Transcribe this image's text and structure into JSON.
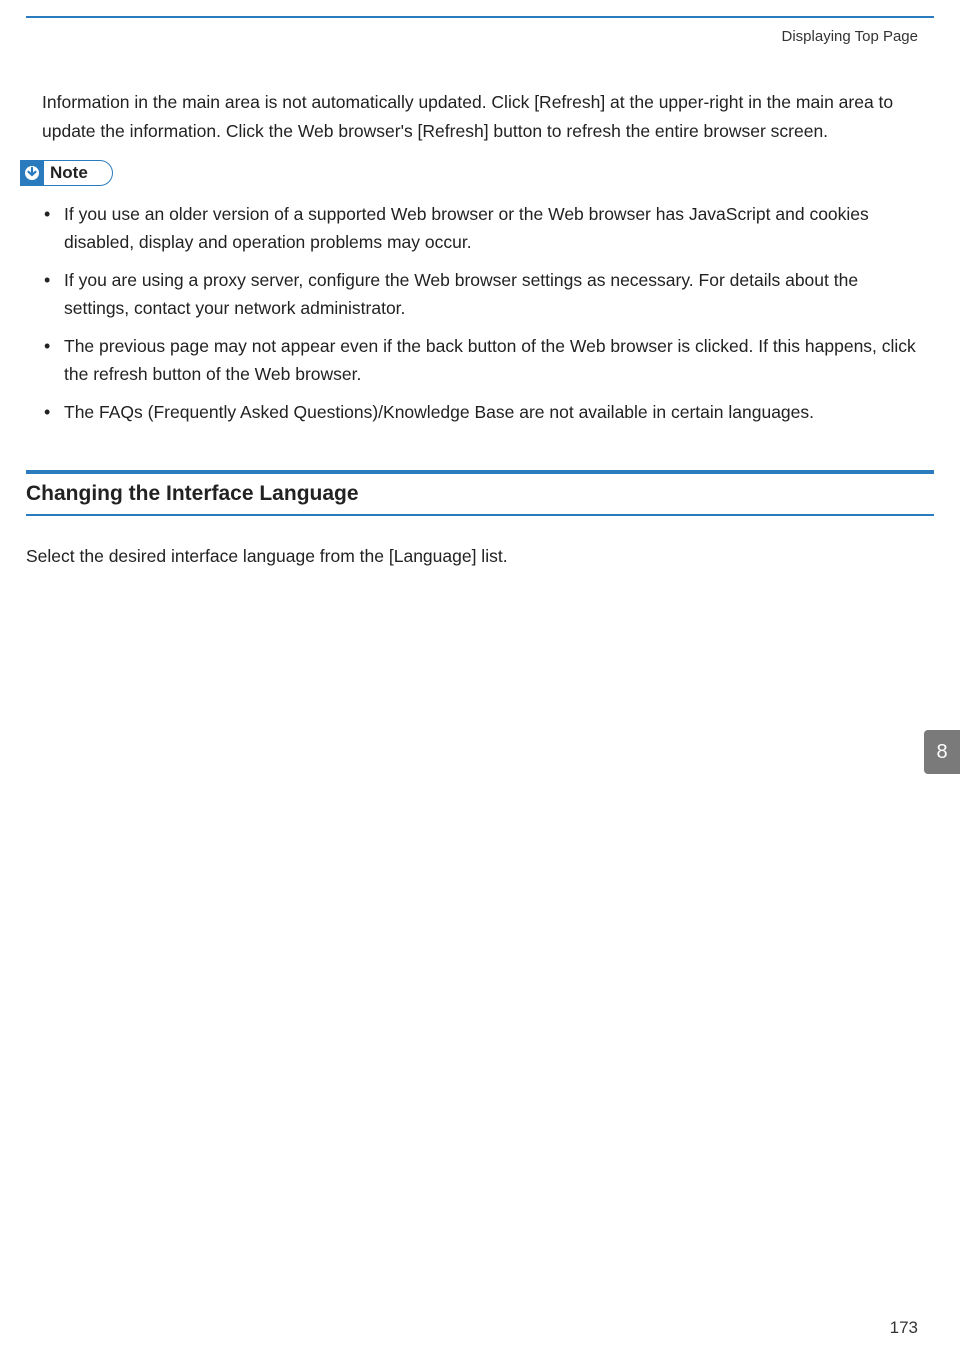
{
  "header": {
    "running_head": "Displaying Top Page"
  },
  "intro_paragraph": "Information in the main area is not automatically updated. Click [Refresh] at the upper-right in the main area to update the information. Click the Web browser's [Refresh] button to refresh the entire browser screen.",
  "note": {
    "label": "Note",
    "items": [
      "If you use an older version of a supported Web browser or the Web browser has JavaScript and cookies disabled, display and operation problems may occur.",
      "If you are using a proxy server, configure the Web browser settings as necessary. For details about the settings, contact your network administrator.",
      "The previous page may not appear even if the back button of the Web browser is clicked. If this happens, click the refresh button of the Web browser.",
      "The FAQs (Frequently Asked Questions)/Knowledge Base are not available in certain languages."
    ]
  },
  "section": {
    "title": "Changing the Interface Language",
    "body": "Select the desired interface language from the [Language] list."
  },
  "side_tab": "8",
  "page_number": "173",
  "colors": {
    "accent": "#2a7bbd",
    "tab_bg": "#7a7a7a"
  }
}
